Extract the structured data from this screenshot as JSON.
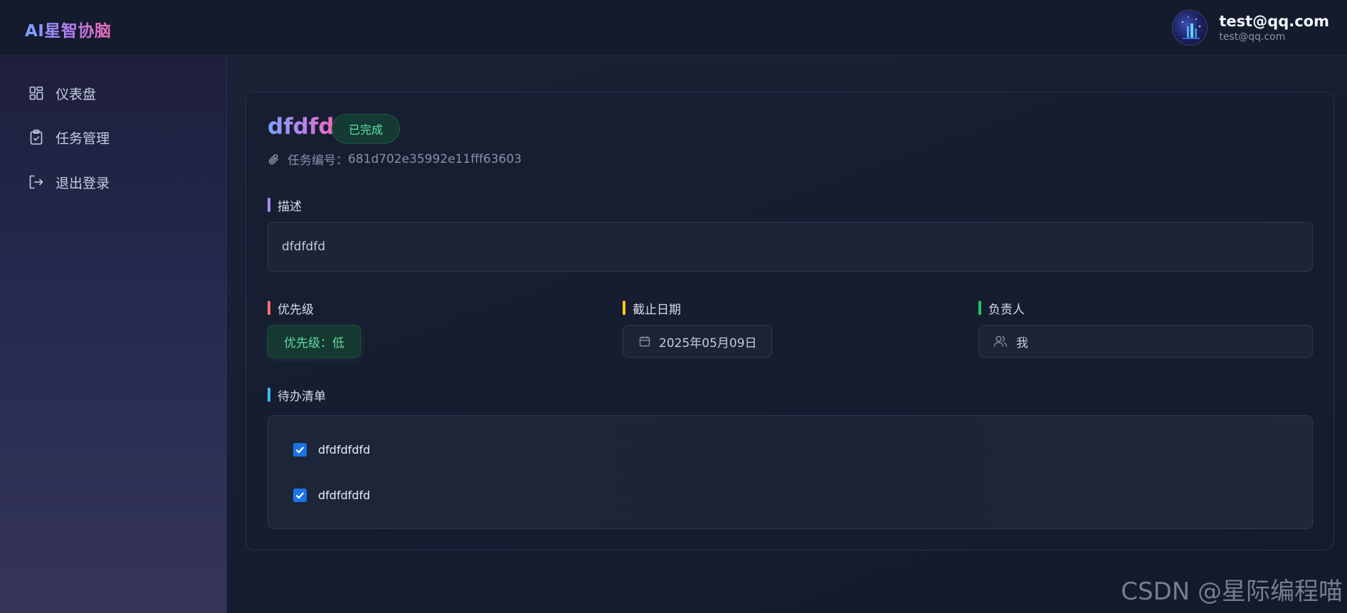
{
  "app": {
    "brand": "AI星智协脑"
  },
  "user": {
    "name": "test@qq.com",
    "email": "test@qq.com"
  },
  "sidebar": {
    "items": [
      {
        "label": "仪表盘",
        "icon": "dashboard-grid-icon"
      },
      {
        "label": "任务管理",
        "icon": "clipboard-check-icon"
      },
      {
        "label": "退出登录",
        "icon": "logout-icon"
      }
    ]
  },
  "task": {
    "title": "dfdfd",
    "status": "已完成",
    "id_label": "任务编号：",
    "id_value": "681d702e35992e11fff63603",
    "description_label": "描述",
    "description": "dfdfdfd",
    "priority_label": "优先级",
    "priority_value": "优先级：低",
    "due_label": "截止日期",
    "due_value": "2025年05月09日",
    "owner_label": "负责人",
    "owner_value": "我",
    "todo_label": "待办清单",
    "todos": [
      {
        "text": "dfdfdfdfd",
        "checked": true
      },
      {
        "text": "dfdfdfdfd",
        "checked": true
      }
    ]
  },
  "colors": {
    "accent_purple": "#a78bfa",
    "accent_red": "#f87171",
    "accent_yellow": "#facc15",
    "accent_green": "#22c55e",
    "accent_blue": "#38bdf8",
    "status_green": "#5ee3a8",
    "checkbox_blue": "#1a73e8"
  },
  "watermark": "CSDN @星际编程喵"
}
